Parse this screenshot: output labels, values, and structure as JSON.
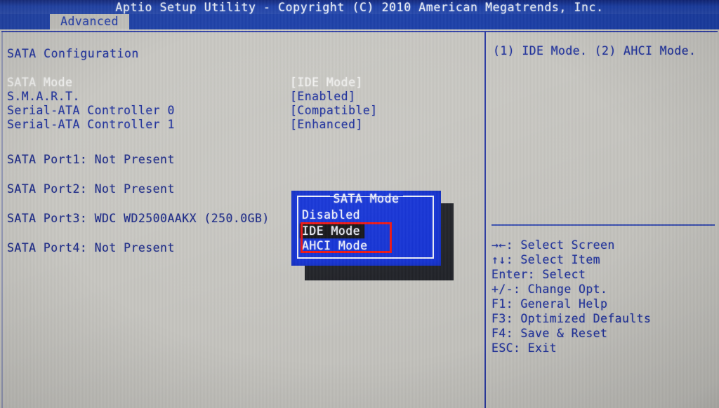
{
  "header": {
    "title": "Aptio Setup Utility - Copyright (C) 2010 American Megatrends, Inc.",
    "tab_label": "Advanced"
  },
  "main": {
    "section_title": "SATA Configuration",
    "options": [
      {
        "label": "SATA Mode",
        "value": "[IDE Mode]",
        "selected": true
      },
      {
        "label": "S.M.A.R.T.",
        "value": "[Enabled]",
        "selected": false
      },
      {
        "label": "Serial-ATA Controller 0",
        "value": "[Compatible]",
        "selected": false
      },
      {
        "label": "Serial-ATA Controller 1",
        "value": "[Enhanced]",
        "selected": false
      }
    ],
    "ports": [
      "SATA Port1: Not Present",
      "SATA Port2: Not Present",
      "SATA Port3: WDC WD2500AAKX (250.0GB)",
      "SATA Port4: Not Present"
    ]
  },
  "popup": {
    "title": "SATA Mode",
    "options": [
      {
        "label": "Disabled",
        "selected": false
      },
      {
        "label": "IDE Mode",
        "selected": true
      },
      {
        "label": "AHCI Mode",
        "selected": false
      }
    ]
  },
  "help": {
    "text": "(1) IDE Mode. (2) AHCI Mode.",
    "keys": [
      "→←: Select Screen",
      "↑↓: Select Item",
      "Enter: Select",
      "+/-: Change Opt.",
      "F1: General Help",
      "F3: Optimized Defaults",
      "F4: Save & Reset",
      "ESC: Exit"
    ]
  },
  "colors": {
    "background": "#c8c7c2",
    "title_bar": "#1b3fa8",
    "text_blue": "#21329c",
    "text_white": "#f0f0ee",
    "popup_blue": "#1030d8",
    "annotation_red": "#ee1111",
    "highlight_bar": "#101014"
  }
}
